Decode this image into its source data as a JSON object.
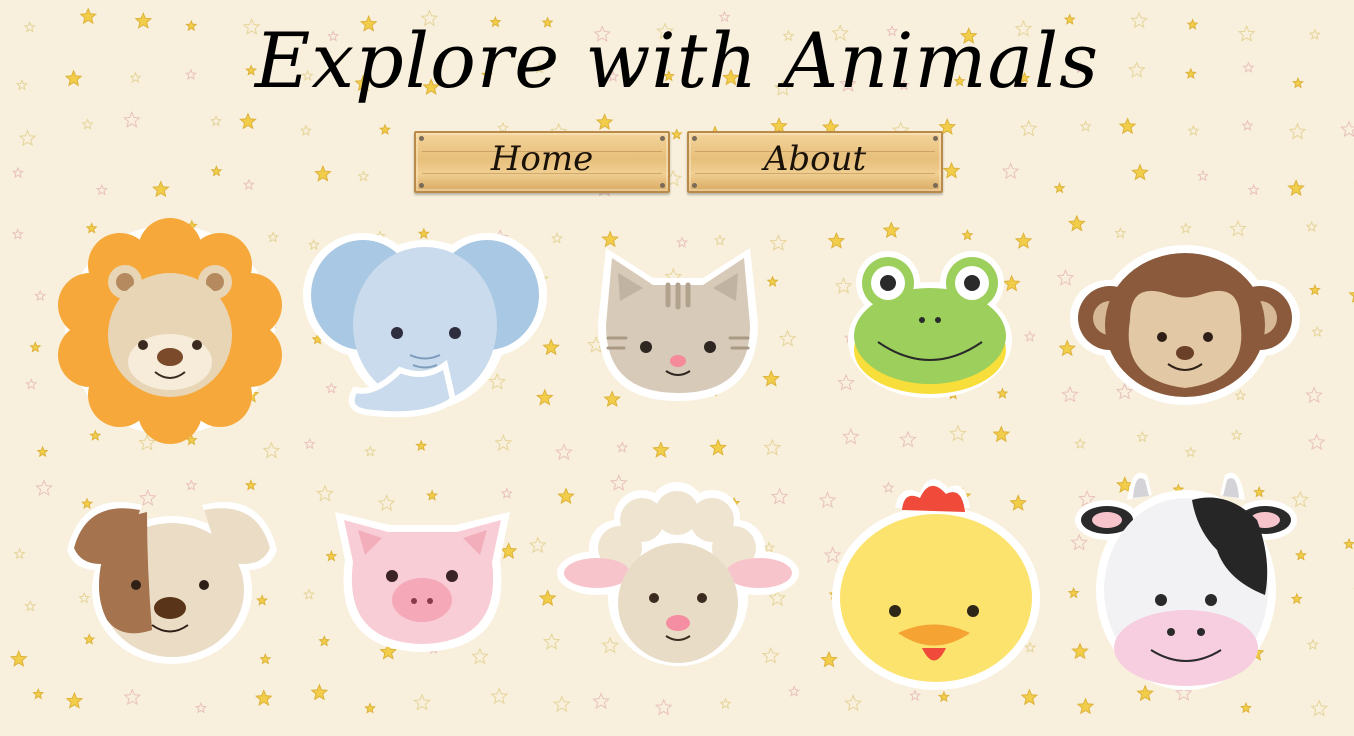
{
  "page": {
    "title": "Explore with Animals"
  },
  "nav": {
    "items": [
      {
        "label": "Home"
      },
      {
        "label": "About"
      }
    ]
  },
  "colors": {
    "background": "#f8f0dc",
    "star": "#f0c830",
    "wood": "#e7bf7b"
  },
  "animals": [
    {
      "name": "lion"
    },
    {
      "name": "elephant"
    },
    {
      "name": "cat"
    },
    {
      "name": "frog"
    },
    {
      "name": "monkey"
    },
    {
      "name": "dog"
    },
    {
      "name": "pig"
    },
    {
      "name": "sheep"
    },
    {
      "name": "chick"
    },
    {
      "name": "cow"
    }
  ]
}
